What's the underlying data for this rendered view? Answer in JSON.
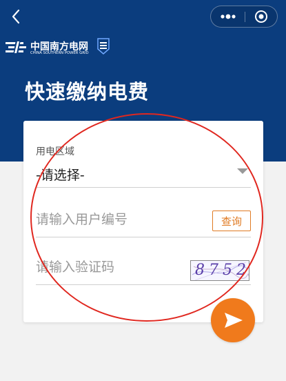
{
  "brand": {
    "name_cn": "中国南方电网",
    "name_en": "CHINA SOUTHERN POWER GRID"
  },
  "page": {
    "title": "快速缴纳电费"
  },
  "form": {
    "area_label": "用电区域",
    "area_select_value": "-请选择-",
    "user_number_placeholder": "请输入用户编号",
    "query_button": "查询",
    "captcha_placeholder": "请输入验证码",
    "captcha_text": "8752"
  },
  "icons": {
    "back": "chevron-left-icon",
    "more": "more-dots-icon",
    "close": "target-close-icon",
    "arrow": "dropdown-arrow-icon",
    "submit": "send-arrow-icon"
  },
  "colors": {
    "header_bg": "#0b3d7e",
    "accent": "#f07a1c",
    "annotation": "#e0271f"
  }
}
